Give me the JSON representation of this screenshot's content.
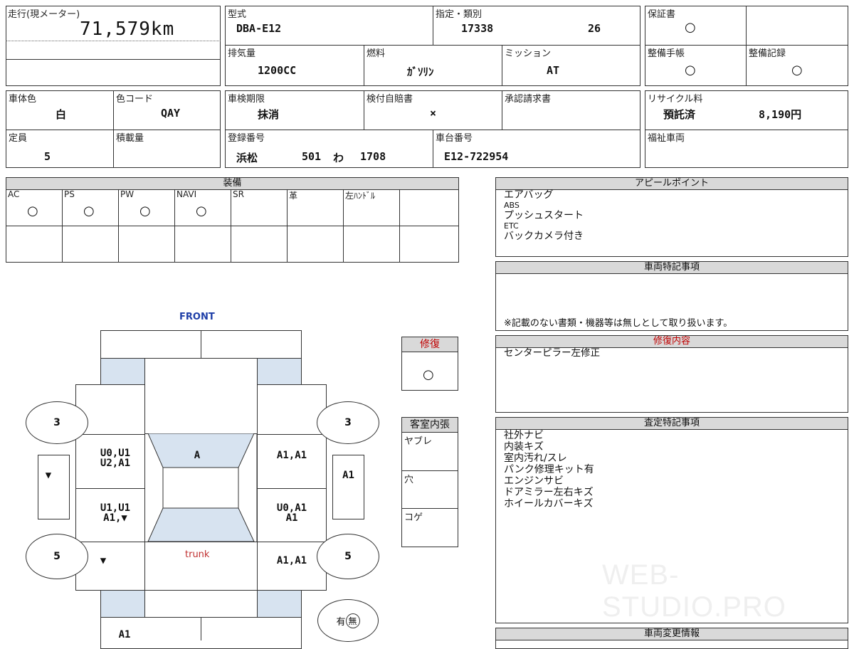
{
  "odometer": {
    "label": "走行(現メーター)",
    "value": "71,579km"
  },
  "model": {
    "label": "型式",
    "value": "DBA-E12"
  },
  "designation": {
    "label": "指定・類別",
    "value1": "17338",
    "value2": "26"
  },
  "displacement": {
    "label": "排気量",
    "value": "1200CC"
  },
  "fuel": {
    "label": "燃料",
    "value": "ｶﾞｿﾘﾝ"
  },
  "transmission": {
    "label": "ミッション",
    "value": "AT"
  },
  "warranty": {
    "label": "保証書",
    "value": "○"
  },
  "maintenance_book": {
    "label": "整備手帳",
    "value": "○"
  },
  "maintenance_record": {
    "label": "整備記録",
    "value": "○"
  },
  "body_color": {
    "label": "車体色",
    "value": "白"
  },
  "color_code": {
    "label": "色コード",
    "value": "QAY"
  },
  "inspection": {
    "label": "車検期限",
    "value": "抹消"
  },
  "insurance": {
    "label": "検付自賠書",
    "value": "×"
  },
  "approval": {
    "label": "承認請求書"
  },
  "recycle": {
    "label": "リサイクル料",
    "status": "預託済",
    "amount": "8,190円"
  },
  "capacity": {
    "label": "定員",
    "value": "5"
  },
  "load": {
    "label": "積載量"
  },
  "registration": {
    "label": "登録番号",
    "area": "浜松",
    "class": "501",
    "kana": "わ",
    "number": "1708"
  },
  "chassis": {
    "label": "車台番号",
    "value": "E12-722954"
  },
  "welfare": {
    "label": "福祉車両"
  },
  "equipment": {
    "title": "装備",
    "items": [
      {
        "label": "AC",
        "value": "○"
      },
      {
        "label": "PS",
        "value": "○"
      },
      {
        "label": "PW",
        "value": "○"
      },
      {
        "label": "NAVI",
        "value": "○"
      },
      {
        "label": "SR",
        "value": ""
      },
      {
        "label": "革",
        "value": ""
      },
      {
        "label": "左ﾊﾝﾄﾞﾙ",
        "value": ""
      }
    ]
  },
  "appeal": {
    "title": "アピールポイント",
    "lines": [
      "エアバッグ",
      "ABS",
      "プッシュスタート",
      "ETC",
      "バックカメラ付き"
    ]
  },
  "special_notes": {
    "title": "車両特記事項",
    "note": "※記載のない書類・機器等は無しとして取り扱います。"
  },
  "repair_detail": {
    "title": "修復内容",
    "text": "センターピラー左修正"
  },
  "assessment": {
    "title": "査定特記事項",
    "lines": [
      "社外ナビ",
      "内装キズ",
      "室内汚れ/スレ",
      "パンク修理キット有",
      "エンジンサビ",
      "ドアミラー左右キズ",
      "ホイールカバーキズ"
    ]
  },
  "change_info": {
    "title": "車両変更情報"
  },
  "repair": {
    "label": "修復",
    "value": "○"
  },
  "interior": {
    "label": "客室内張",
    "rows": [
      "ヤブレ",
      "穴",
      "コゲ"
    ]
  },
  "diagram": {
    "front": "FRONT",
    "trunk": "trunk",
    "tire_fl": "3",
    "tire_fr": "3",
    "tire_rl": "5",
    "tire_rr": "5",
    "left_front": "U0,U1\nU2,A1",
    "roof": "A",
    "right_front": "A1,A1",
    "left_mirror": "▼",
    "right_mirror": "A1",
    "left_rear_door": "U1,U1\nA1,▼",
    "right_rear_door": "U0,A1\nA1",
    "left_quarter": "▼",
    "right_quarter": "A1,A1",
    "rear_bumper": "A1",
    "spare": "有",
    "spare_none": "無"
  },
  "watermark": "WEB-STUDIO.PRO"
}
